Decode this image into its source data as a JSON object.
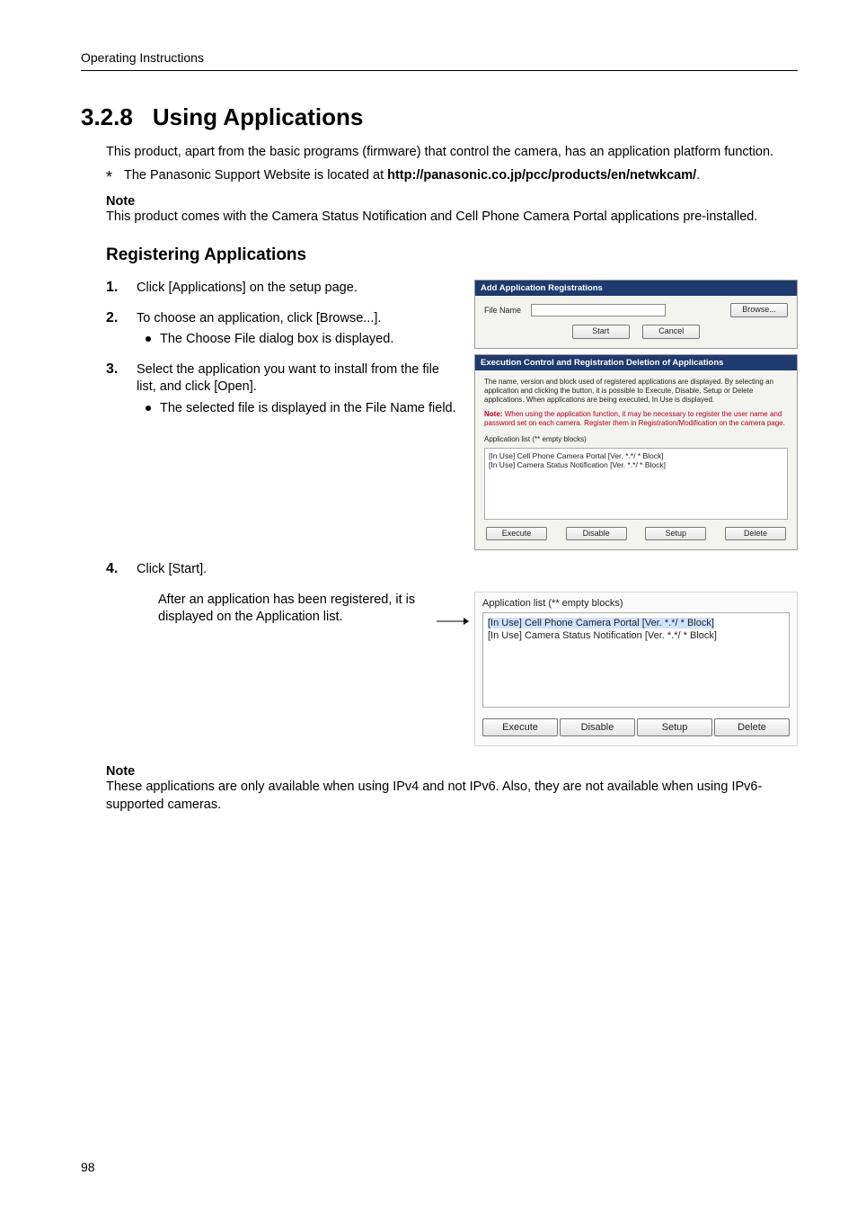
{
  "running_head": "Operating Instructions",
  "section_number": "3.2.8",
  "section_title": "Using Applications",
  "intro": "This product, apart from the basic programs (firmware) that control the camera, has an application platform function.",
  "star_note_pre": "The Panasonic Support Website is located at ",
  "star_note_bold": "http://panasonic.co.jp/pcc/products/en/netwkcam/",
  "star_note_post": ".",
  "note1_head": "Note",
  "note1_body": "This product comes with the Camera Status Notification and Cell Phone Camera Portal applications pre-installed.",
  "h2": "Registering Applications",
  "steps": {
    "s1": "Click [Applications] on the setup page.",
    "s2": "To choose an application, click [Browse...].",
    "s2b": "The Choose File dialog box is displayed.",
    "s3a": "Select the application you want to install from the file list, and click [Open].",
    "s3b": "The selected file is displayed in the File Name field.",
    "s4": "Click [Start]."
  },
  "panel_a": {
    "title1": "Add Application Registrations",
    "file_label": "File Name",
    "browse": "Browse...",
    "start": "Start",
    "cancel": "Cancel",
    "title2": "Execution Control and Registration Deletion of Applications",
    "desc": "The name, version and block used of registered applications are displayed. By selecting an application and clicking the button, it is possible to Execute, Disable, Setup or Delete applications. When applications are being executed, In Use is displayed.",
    "warn_label": "Note:",
    "warn": "When using the application function, it may be necessary to register the user name and password set on each camera. Register them in Registration/Modification on the camera page.",
    "list_caption": "Application list (** empty blocks)",
    "list_items": [
      "[In Use]  Cell Phone Camera Portal  [Ver. *.*/ * Block]",
      "[In Use]  Camera Status Notification  [Ver. *.*/ * Block]"
    ],
    "btns": {
      "execute": "Execute",
      "disable": "Disable",
      "setup": "Setup",
      "delete": "Delete"
    }
  },
  "lower_left": "After an application has been registered, it is displayed on the Application list.",
  "panel_b": {
    "caption": "Application list (** empty blocks)",
    "items": [
      "[In Use]  Cell Phone Camera Portal  [Ver. *.*/ * Block]",
      "[In Use]  Camera Status Notification  [Ver. *.*/ * Block]"
    ],
    "btns": {
      "execute": "Execute",
      "disable": "Disable",
      "setup": "Setup",
      "delete": "Delete"
    }
  },
  "note2_head": "Note",
  "note2_body": "These applications are only available when using IPv4 and not IPv6. Also, they are not available when using IPv6-supported cameras.",
  "page_number": "98"
}
